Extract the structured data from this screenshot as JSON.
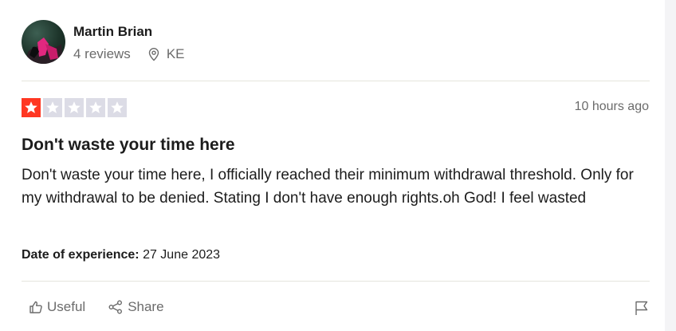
{
  "reviewer": {
    "name": "Martin Brian",
    "reviews_count": "4 reviews",
    "country": "KE"
  },
  "rating": {
    "value": 1,
    "max": 5,
    "filled_color": "#ff3722",
    "empty_color": "#dcdce6"
  },
  "review": {
    "time_ago": "10 hours ago",
    "title": "Don't waste your time here",
    "body": "Don't waste your time here, I officially reached their minimum withdrawal threshold. Only for my withdrawal to be denied. Stating I don't have enough rights.oh God! I feel wasted",
    "experience_label": "Date of experience:",
    "experience_date": "27 June 2023"
  },
  "actions": {
    "useful_label": "Useful",
    "share_label": "Share"
  }
}
